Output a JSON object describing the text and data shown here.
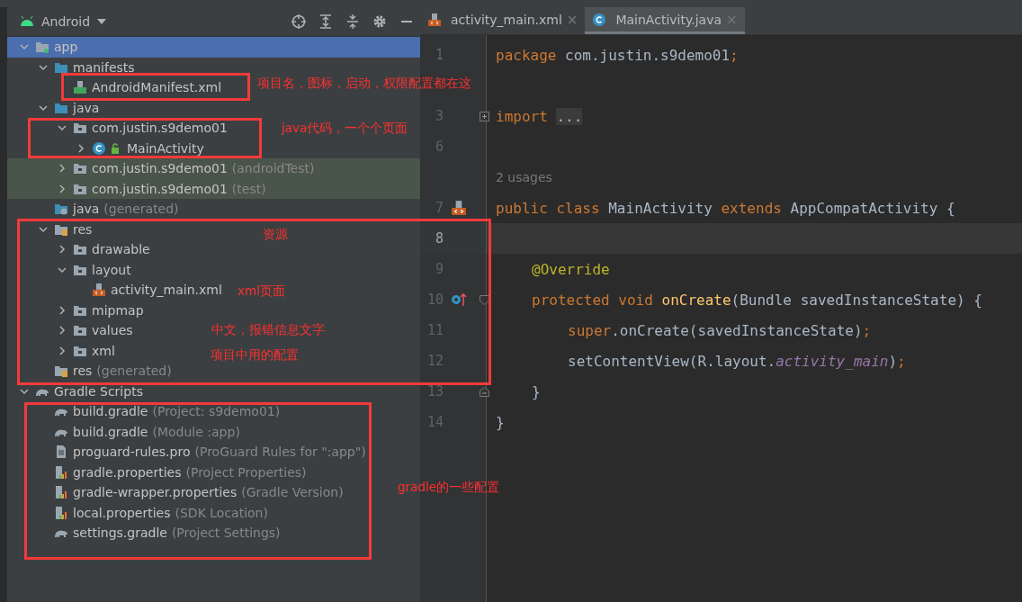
{
  "project_panel": {
    "view_selector": "Android",
    "tree": [
      {
        "label": "app",
        "kind": "module",
        "expanded": true,
        "selected": true,
        "tinted": false,
        "children": [
          {
            "label": "manifests",
            "kind": "source-folder",
            "expanded": true,
            "selected": false,
            "tinted": false,
            "children": [
              {
                "label": "AndroidManifest.xml",
                "kind": "manifest",
                "selected": false,
                "tinted": false
              }
            ]
          },
          {
            "label": "java",
            "kind": "source-folder",
            "expanded": true,
            "selected": false,
            "tinted": false,
            "children": [
              {
                "label": "com.justin.s9demo01",
                "kind": "package",
                "expanded": true,
                "selected": false,
                "tinted": false,
                "children": [
                  {
                    "label": "MainActivity",
                    "kind": "class",
                    "expanded": false,
                    "selected": false,
                    "tinted": false
                  }
                ]
              },
              {
                "label": "com.justin.s9demo01",
                "suffix": "(androidTest)",
                "kind": "package",
                "expanded": false,
                "selected": false,
                "tinted": true
              },
              {
                "label": "com.justin.s9demo01",
                "suffix": "(test)",
                "kind": "package",
                "expanded": false,
                "selected": false,
                "tinted": true
              }
            ]
          },
          {
            "label": "java",
            "suffix": "(generated)",
            "kind": "generated-folder",
            "selected": false,
            "tinted": false
          },
          {
            "label": "res",
            "kind": "resource-folder",
            "expanded": true,
            "selected": false,
            "tinted": false,
            "children": [
              {
                "label": "drawable",
                "kind": "package",
                "expanded": false,
                "selected": false,
                "tinted": false
              },
              {
                "label": "layout",
                "kind": "package",
                "expanded": true,
                "selected": false,
                "tinted": false,
                "children": [
                  {
                    "label": "activity_main.xml",
                    "kind": "xml",
                    "selected": false,
                    "tinted": false
                  }
                ]
              },
              {
                "label": "mipmap",
                "kind": "package",
                "expanded": false,
                "selected": false,
                "tinted": false
              },
              {
                "label": "values",
                "kind": "package",
                "expanded": false,
                "selected": false,
                "tinted": false
              },
              {
                "label": "xml",
                "kind": "package",
                "expanded": false,
                "selected": false,
                "tinted": false
              }
            ]
          },
          {
            "label": "res",
            "suffix": "(generated)",
            "kind": "resource-folder",
            "selected": false,
            "tinted": false
          }
        ]
      },
      {
        "label": "Gradle Scripts",
        "kind": "gradle",
        "expanded": true,
        "selected": false,
        "tinted": false,
        "children": [
          {
            "label": "build.gradle",
            "suffix": "(Project: s9demo01)",
            "kind": "gradle",
            "selected": false,
            "tinted": false
          },
          {
            "label": "build.gradle",
            "suffix": "(Module :app)",
            "kind": "gradle",
            "selected": false,
            "tinted": false
          },
          {
            "label": "proguard-rules.pro",
            "suffix": "(ProGuard Rules for \":app\")",
            "kind": "text-file",
            "selected": false,
            "tinted": false
          },
          {
            "label": "gradle.properties",
            "suffix": "(Project Properties)",
            "kind": "properties",
            "selected": false,
            "tinted": false
          },
          {
            "label": "gradle-wrapper.properties",
            "suffix": "(Gradle Version)",
            "kind": "properties",
            "selected": false,
            "tinted": false
          },
          {
            "label": "local.properties",
            "suffix": "(SDK Location)",
            "kind": "properties",
            "selected": false,
            "tinted": false
          },
          {
            "label": "settings.gradle",
            "suffix": "(Project Settings)",
            "kind": "gradle",
            "selected": false,
            "tinted": false
          }
        ]
      }
    ]
  },
  "editor": {
    "tabs": [
      {
        "label": "activity_main.xml",
        "kind": "xml",
        "close": "×",
        "selected": false
      },
      {
        "label": "MainActivity.java",
        "kind": "class",
        "close": "×",
        "selected": true
      }
    ],
    "lines": [
      {
        "kind": "top",
        "number": "1",
        "current": false,
        "tokens": [
          {
            "text": "package ",
            "kind": "keyword"
          },
          {
            "text": "com.justin.s9demo01",
            "kind": "plain"
          },
          {
            "text": ";",
            "kind": "keyword"
          }
        ]
      },
      {
        "kind": "top",
        "current": false
      },
      {
        "kind": "top",
        "number": "3",
        "current": false,
        "fold": {
          "kind": "expand"
        },
        "tokens": [
          {
            "text": "import ",
            "kind": "keyword"
          },
          {
            "text": "...",
            "kind": "folded"
          }
        ]
      },
      {
        "kind": "top",
        "number": "6",
        "current": false
      },
      {
        "kind": "inlay",
        "text": "2 usages"
      },
      {
        "kind": "top",
        "number": "7",
        "current": false,
        "marker": {
          "kind": "xml"
        },
        "tokens": [
          {
            "text": "public class ",
            "kind": "keyword"
          },
          {
            "text": "MainActivity ",
            "kind": "plain"
          },
          {
            "text": "extends ",
            "kind": "keyword"
          },
          {
            "text": "AppCompatActivity {",
            "kind": "plain"
          }
        ]
      },
      {
        "kind": "top",
        "number": "8",
        "current": true
      },
      {
        "kind": "member",
        "number": "9",
        "current": false,
        "tokens": [
          {
            "text": "@Override",
            "kind": "annotation"
          }
        ]
      },
      {
        "kind": "member",
        "number": "10",
        "current": false,
        "marker": {
          "kind": "override"
        },
        "fold": {
          "kind": "open"
        },
        "tokens": [
          {
            "text": "protected void ",
            "kind": "keyword"
          },
          {
            "text": "onCreate",
            "kind": "method"
          },
          {
            "text": "(Bundle savedInstanceState) {",
            "kind": "plain"
          }
        ]
      },
      {
        "kind": "body",
        "number": "11",
        "current": false,
        "tokens": [
          {
            "text": "super",
            "kind": "keyword"
          },
          {
            "text": ".onCreate(savedInstanceState)",
            "kind": "plain"
          },
          {
            "text": ";",
            "kind": "keyword"
          }
        ]
      },
      {
        "kind": "body",
        "number": "12",
        "current": false,
        "tokens": [
          {
            "text": "setContentView(R.layout.",
            "kind": "plain"
          },
          {
            "text": "activity_main",
            "kind": "field"
          },
          {
            "text": ")",
            "kind": "plain"
          },
          {
            "text": ";",
            "kind": "keyword"
          }
        ]
      },
      {
        "kind": "member",
        "number": "13",
        "current": false,
        "fold": {
          "kind": "close"
        },
        "tokens": [
          {
            "text": "}",
            "kind": "plain"
          }
        ]
      },
      {
        "kind": "top",
        "number": "14",
        "current": false,
        "tokens": [
          {
            "text": "}",
            "kind": "plain"
          }
        ]
      }
    ]
  },
  "annotations": [
    {
      "text": "项目名，图标，启动，权限配置都在这"
    },
    {
      "text": "java代码，一个个页面"
    },
    {
      "text": "资源"
    },
    {
      "text": "xml页面"
    },
    {
      "text": "中文，报错信息文字"
    },
    {
      "text": "项目中用的配置"
    },
    {
      "text": "gradle的一些配置"
    }
  ]
}
